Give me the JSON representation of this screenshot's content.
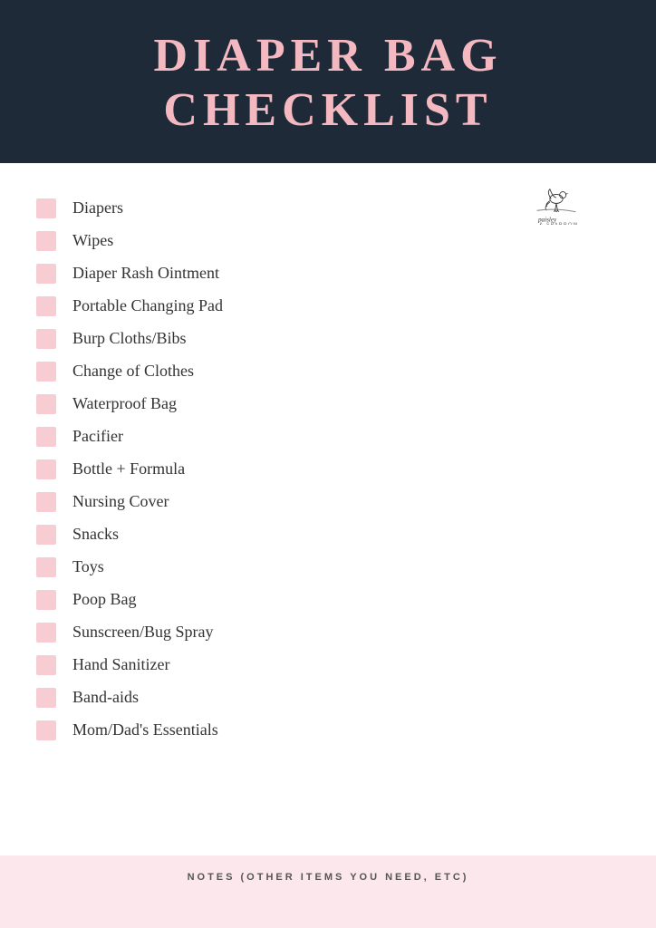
{
  "header": {
    "title_line1": "DIAPER BAG",
    "title_line2": "CHECKLIST"
  },
  "checklist": {
    "items": [
      {
        "id": 1,
        "label": "Diapers"
      },
      {
        "id": 2,
        "label": "Wipes"
      },
      {
        "id": 3,
        "label": "Diaper Rash Ointment"
      },
      {
        "id": 4,
        "label": "Portable Changing Pad"
      },
      {
        "id": 5,
        "label": "Burp Cloths/Bibs"
      },
      {
        "id": 6,
        "label": "Change of Clothes"
      },
      {
        "id": 7,
        "label": "Waterproof Bag"
      },
      {
        "id": 8,
        "label": "Pacifier"
      },
      {
        "id": 9,
        "label": "Bottle + Formula"
      },
      {
        "id": 10,
        "label": "Nursing Cover"
      },
      {
        "id": 11,
        "label": "Snacks"
      },
      {
        "id": 12,
        "label": "Toys"
      },
      {
        "id": 13,
        "label": "Poop Bag"
      },
      {
        "id": 14,
        "label": "Sunscreen/Bug Spray"
      },
      {
        "id": 15,
        "label": "Hand Sanitizer"
      },
      {
        "id": 16,
        "label": "Band-aids"
      },
      {
        "id": 17,
        "label": "Mom/Dad's Essentials"
      }
    ]
  },
  "notes": {
    "label": "NOTES (OTHER ITEMS YOU NEED, ETC)"
  },
  "logo": {
    "alt": "Paisley and Sparrow logo"
  }
}
